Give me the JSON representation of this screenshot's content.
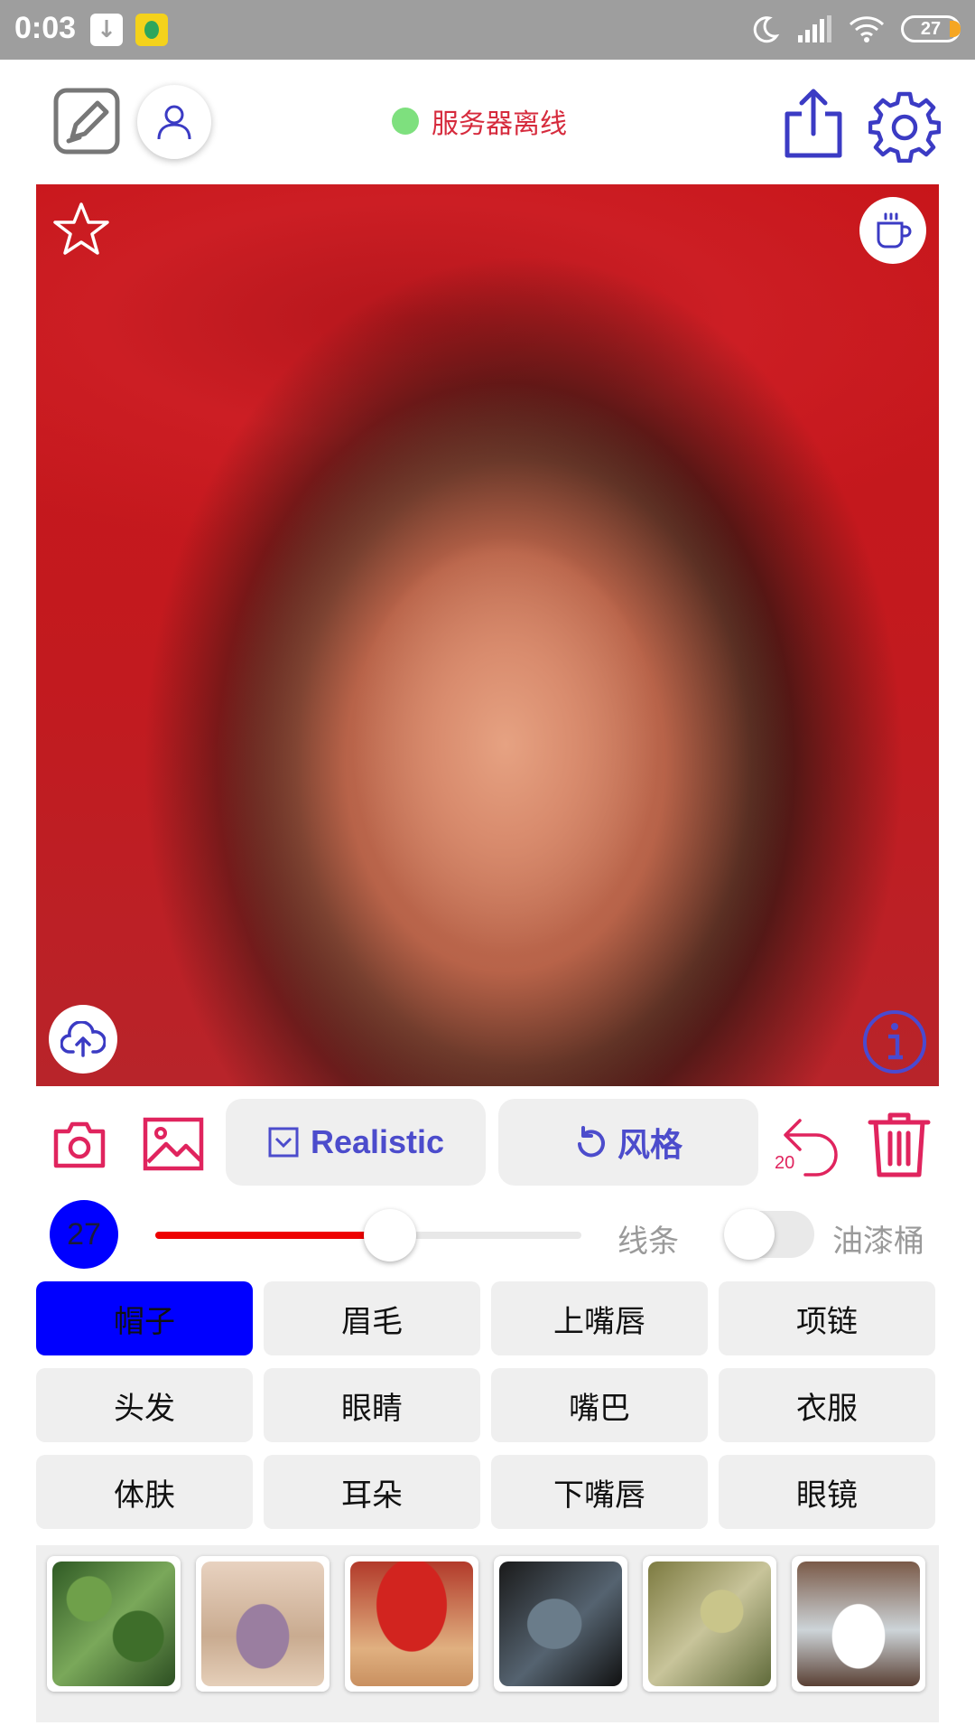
{
  "status_bar": {
    "time": "0:03",
    "battery": "27",
    "icons": [
      "download-icon",
      "music-app-icon",
      "moon-icon",
      "signal-icon",
      "wifi-icon",
      "battery-icon"
    ]
  },
  "header": {
    "server_status": "服务器离线",
    "status_color": "#7ee07e"
  },
  "toolbar": {
    "realistic_label": "Realistic",
    "style_label": "风格",
    "undo_count": "20",
    "accent": "#4c4ccc",
    "danger": "#e0245e"
  },
  "brush": {
    "size": "27",
    "slider_fraction": 0.55,
    "lines_label": "线条",
    "bucket_label": "油漆桶",
    "bucket_on": false
  },
  "parts": [
    {
      "label": "帽子",
      "active": true
    },
    {
      "label": "眉毛",
      "active": false
    },
    {
      "label": "上嘴唇",
      "active": false
    },
    {
      "label": "项链",
      "active": false
    },
    {
      "label": "头发",
      "active": false
    },
    {
      "label": "眼睛",
      "active": false
    },
    {
      "label": "嘴巴",
      "active": false
    },
    {
      "label": "衣服",
      "active": false
    },
    {
      "label": "体肤",
      "active": false
    },
    {
      "label": "耳朵",
      "active": false
    },
    {
      "label": "下嘴唇",
      "active": false
    },
    {
      "label": "眼镜",
      "active": false
    }
  ],
  "style_thumbs": [
    {
      "name": "green-foliage"
    },
    {
      "name": "lilac-bouquet"
    },
    {
      "name": "red-tree"
    },
    {
      "name": "dark-smoke"
    },
    {
      "name": "olive-branches"
    },
    {
      "name": "misty-water"
    }
  ]
}
